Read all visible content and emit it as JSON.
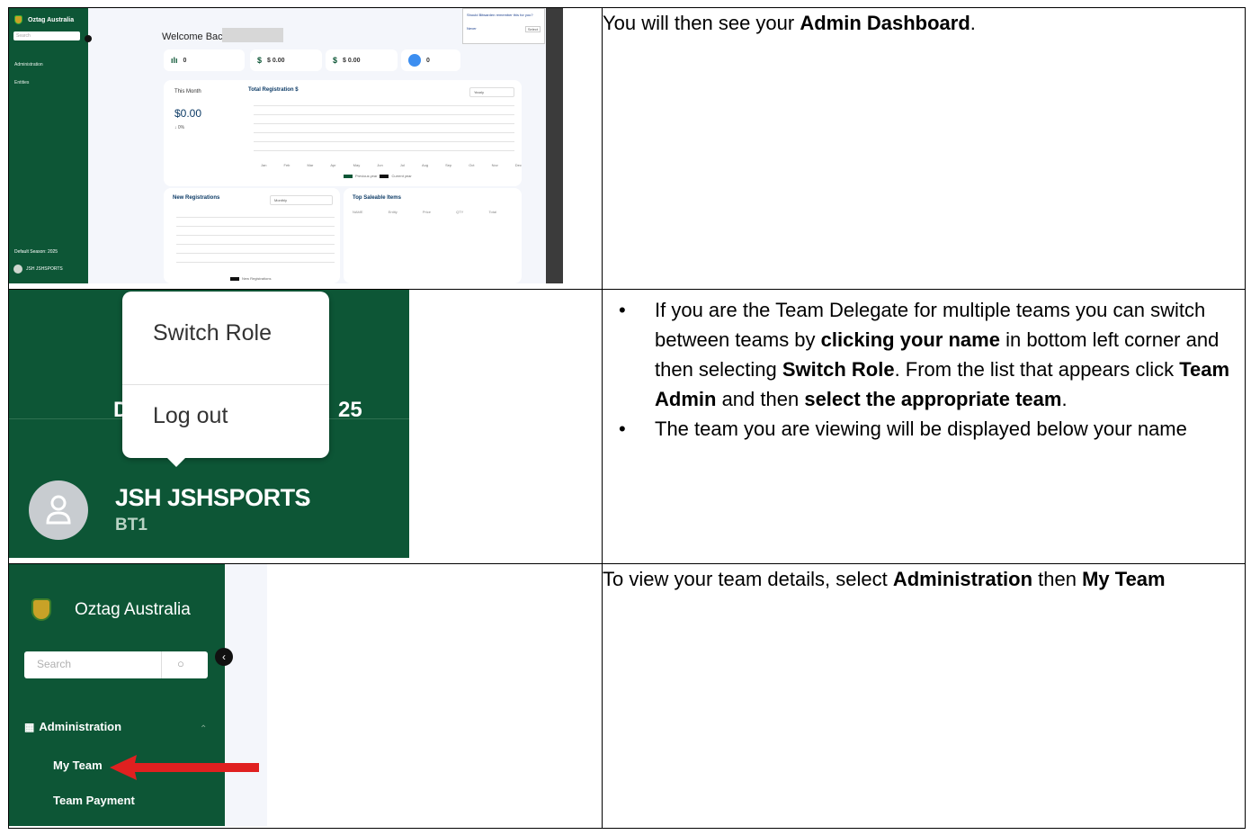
{
  "rows": [
    {
      "text_pre": "You will then see your ",
      "text_bold": "Admin Dashboard",
      "text_post": "."
    },
    {
      "bullets": [
        {
          "t1": "If you are the Team Delegate for multiple teams you can switch between teams by ",
          "b1": "clicking your name",
          "t2": " in bottom left corner and then selecting ",
          "b2": "Switch Role",
          "t3": ". From the list that appears click ",
          "b3": "Team Admin",
          "t4": " and then ",
          "b4": "select the appropriate team",
          "t5": "."
        },
        {
          "t1": "The team you are viewing will be displayed below your name"
        }
      ]
    },
    {
      "t1": "To view your team details, select ",
      "b1": "Administration",
      "t2": " then ",
      "b2": "My Team"
    }
  ],
  "dashboard": {
    "brand": "Oztag Australia",
    "search": "Search",
    "nav": [
      "Administration",
      "Entities"
    ],
    "season": "Default Season: 2025",
    "user": "JSH JSHSPORTS",
    "welcome": "Welcome Back,",
    "stats": [
      {
        "icon": "ılı",
        "value": "0"
      },
      {
        "icon": "$",
        "value": "$ 0.00"
      },
      {
        "icon": "$",
        "value": "$ 0.00"
      },
      {
        "icon": "",
        "value": "0"
      }
    ],
    "this_month": "This Month",
    "total_title": "Total Registration $",
    "amount": "$0.00",
    "delta": "↓ 0%",
    "yearly": "Yearly",
    "months": [
      "Jan",
      "Feb",
      "Mar",
      "Apr",
      "May",
      "Jun",
      "Jul",
      "Aug",
      "Sep",
      "Oct",
      "Nov",
      "Dec"
    ],
    "legend": [
      "Previous year",
      "Current year"
    ],
    "new_reg": "New Registrations",
    "monthly": "Monthly",
    "new_reg_legend": "New Registrations",
    "top_items": "Top Saleable Items",
    "item_cols": [
      "NAME",
      "Entity",
      "Price",
      "QTY",
      "Total"
    ],
    "popup_q": "Should Bitwarden remember this for you?",
    "popup_never": "Never",
    "popup_select": "Select"
  },
  "role_menu": {
    "items": [
      "Switch Role",
      "Log out"
    ],
    "ghost_left": "D",
    "ghost_right": "25",
    "user": "JSH JSHSPORTS",
    "team": "BT1"
  },
  "admin_menu": {
    "brand": "Oztag Australia",
    "search": "Search",
    "section": "Administration",
    "items": [
      "My Team",
      "Team Payment"
    ]
  }
}
